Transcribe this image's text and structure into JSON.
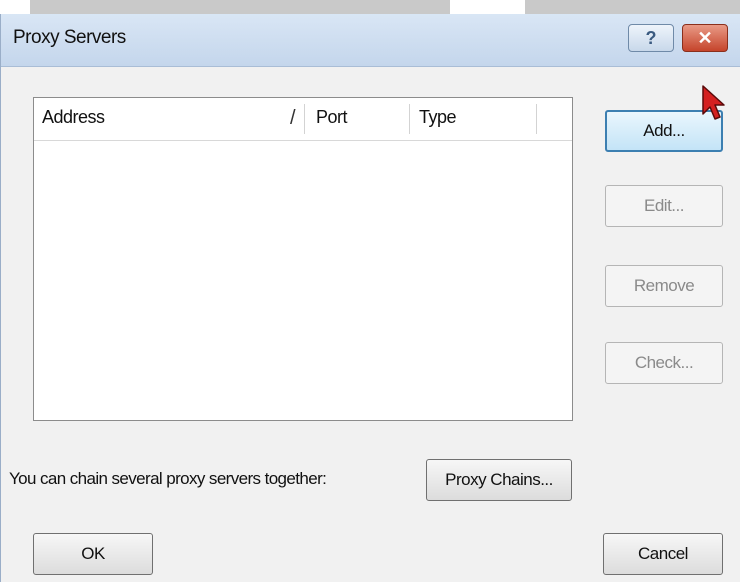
{
  "window": {
    "title": "Proxy Servers"
  },
  "titlebar": {
    "help_glyph": "?",
    "close_glyph": "✕"
  },
  "list": {
    "columns": [
      {
        "label": "Address"
      },
      {
        "label": "Port"
      },
      {
        "label": "Type"
      }
    ],
    "sort_indicator": "/"
  },
  "buttons": {
    "add": "Add...",
    "edit": "Edit...",
    "remove": "Remove",
    "check": "Check...",
    "proxy_chains": "Proxy Chains...",
    "ok": "OK",
    "cancel": "Cancel"
  },
  "chain_note": "You can chain several proxy servers together:",
  "icons": {
    "cursor": "arrow-cursor-icon",
    "help": "help-icon",
    "close": "close-icon"
  },
  "colors": {
    "close_button": "#c5442b",
    "default_button_border": "#3c7fb1",
    "cursor": "#d42020"
  }
}
